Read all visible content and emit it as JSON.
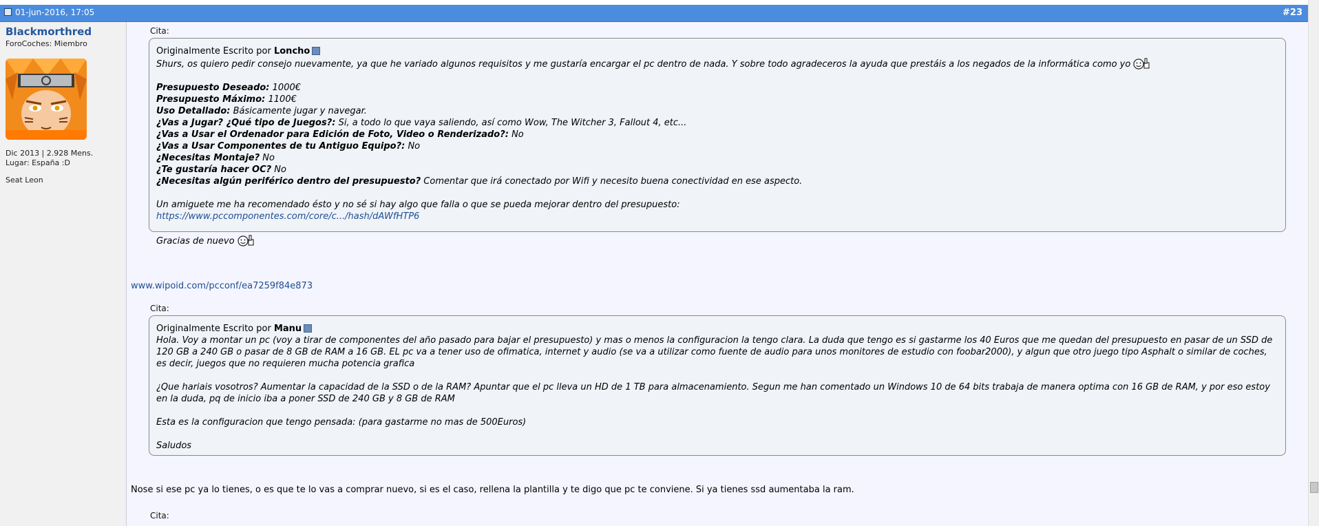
{
  "header": {
    "date": "01-jun-2016, 17:05",
    "post_number": "#23"
  },
  "user": {
    "name": "Blackmorthred",
    "title": "ForoCoches: Miembro",
    "joined_posts": "Dic 2013 | 2.928 Mens.",
    "location": "Lugar: España :D",
    "car": "Seat Leon"
  },
  "quote1": {
    "cita": "Cita:",
    "written_by": "Originalmente Escrito por",
    "author": "Loncho",
    "intro": "Shurs, os quiero pedir consejo nuevamente, ya que he variado algunos requisitos y me gustaría encargar el pc dentro de nada. Y sobre todo agradeceros la ayuda que prestáis a los negados de la informática como yo",
    "fields": [
      {
        "label": "Presupuesto Deseado:",
        "value": " 1000€"
      },
      {
        "label": "Presupuesto Máximo:",
        "value": " 1100€"
      },
      {
        "label": "Uso Detallado:",
        "value": " Básicamente jugar y navegar."
      },
      {
        "label": "¿Vas a Jugar? ¿Qué tipo de Juegos?:",
        "value": " Si, a todo lo que vaya saliendo, así como Wow, The Witcher 3, Fallout 4, etc..."
      },
      {
        "label": "¿Vas a Usar el Ordenador para Edición de Foto, Video o Renderizado?:",
        "value": " No"
      },
      {
        "label": "¿Vas a Usar Componentes de tu Antiguo Equipo?:",
        "value": " No"
      },
      {
        "label": "¿Necesitas Montaje?",
        "value": " No"
      },
      {
        "label": "¿Te gustaría hacer OC?",
        "value": " No"
      },
      {
        "label": "¿Necesitas algún periférico dentro del presupuesto?",
        "value": " Comentar que irá conectado por Wifi y necesito buena conectividad en ese aspecto."
      }
    ],
    "friend_text": "Un amiguete me ha recomendado ésto y no sé si hay algo que falla o que se pueda mejorar dentro del presupuesto:",
    "link": "https://www.pccomponentes.com/core/c.../hash/dAWfHTP6",
    "thanks": "Gracias de nuevo"
  },
  "wipoid_link": "www.wipoid.com/pcconf/ea7259f84e873",
  "quote2": {
    "cita": "Cita:",
    "written_by": "Originalmente Escrito por",
    "author": "Manu",
    "p1": "Hola. Voy a montar un pc (voy a tirar de componentes del año pasado para bajar el presupuesto) y mas o menos la configuracion la tengo clara. La duda que tengo es si gastarme los 40 Euros que me quedan del presupuesto en pasar de un SSD de 120 GB a 240 GB o pasar de 8 GB de RAM a 16 GB. EL pc va a tener uso de ofimatica, internet y audio (se va a utilizar como fuente de audio para unos monitores de estudio con foobar2000), y algun que otro juego tipo Asphalt o similar de coches, es decir, juegos que no requieren mucha potencia grafica",
    "p2": "¿Que hariais vosotros? Aumentar la capacidad de la SSD o de la RAM? Apuntar que el pc lleva un HD de 1 TB para almacenamiento. Segun me han comentado un Windows 10 de 64 bits trabaja de manera optima con 16 GB de RAM, y por eso estoy en la duda, pq de inicio iba a poner SSD de 240 GB y 8 GB de RAM",
    "p3": "Esta es la configuracion que tengo pensada: (para gastarme no mas de 500Euros)",
    "p4": "Saludos"
  },
  "reply_text": "Nose si ese pc ya lo tienes, o es que te lo vas a comprar nuevo, si es el caso, rellena la plantilla y te digo que pc te conviene. Si ya tienes ssd aumentaba la ram.",
  "quote3": {
    "cita": "Cita:"
  },
  "icons": [
    "post-icon",
    "view-post-icon",
    "thumbs-up-smiley-icon",
    "avatar-image"
  ],
  "colors": {
    "header_bar": "#4b8cde",
    "username": "#24579c",
    "link": "#1d4e93",
    "quote_bg": "#f0f3f8"
  }
}
